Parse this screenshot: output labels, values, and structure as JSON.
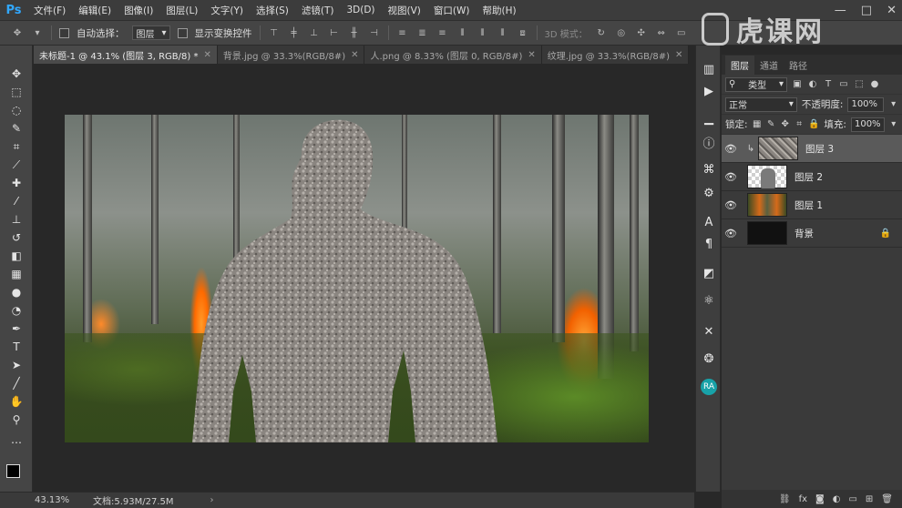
{
  "app": {
    "logo": "Ps"
  },
  "menu": [
    "文件(F)",
    "编辑(E)",
    "图像(I)",
    "图层(L)",
    "文字(Y)",
    "选择(S)",
    "滤镜(T)",
    "3D(D)",
    "视图(V)",
    "窗口(W)",
    "帮助(H)"
  ],
  "window_controls": [
    "—",
    "□",
    "✕"
  ],
  "options": {
    "auto_select_label": "自动选择：",
    "auto_select_value": "图层",
    "show_transform_label": "显示变换控件",
    "mode_3d_label": "3D 模式："
  },
  "tabs": [
    {
      "label": "未标题-1 @ 43.1% (图层 3, RGB/8) *",
      "close": "✕"
    },
    {
      "label": "背景.jpg @ 33.3%(RGB/8#)",
      "close": "✕"
    },
    {
      "label": "人.png @ 8.33% (图层 0, RGB/8#)",
      "close": "✕"
    },
    {
      "label": "纹理.jpg @ 33.3%(RGB/8#)",
      "close": "✕"
    }
  ],
  "layers_panel": {
    "tabs": [
      "图层",
      "通道",
      "路径"
    ],
    "filter_kind": "类型",
    "blend_mode": "正常",
    "opacity_label": "不透明度:",
    "opacity_value": "100%",
    "lock_label": "锁定:",
    "fill_label": "填充:",
    "fill_value": "100%",
    "layers": [
      {
        "name": "图层 3",
        "selected": true,
        "thumb": "texture"
      },
      {
        "name": "图层 2",
        "selected": false,
        "thumb": "person"
      },
      {
        "name": "图层 1",
        "selected": false,
        "thumb": "forest"
      },
      {
        "name": "背景",
        "selected": false,
        "thumb": "black",
        "locked": true
      }
    ],
    "footer_icons": [
      "link-icon",
      "fx-icon",
      "mask-icon",
      "adjustment-icon",
      "group-icon",
      "new-layer-icon",
      "trash-icon"
    ]
  },
  "status": {
    "zoom": "43.13%",
    "doc": "文档:5.93M/27.5M",
    "arrow": "›"
  },
  "watermark": {
    "text": "虎课网"
  }
}
